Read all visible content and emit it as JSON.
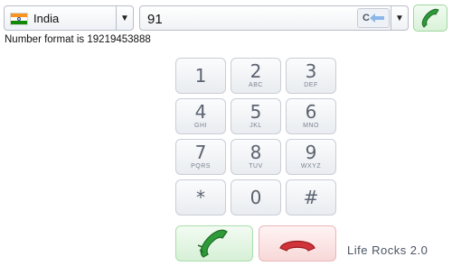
{
  "country": {
    "name": "India"
  },
  "phone": {
    "value": "91",
    "clear_label": "C"
  },
  "hint": {
    "text": "Number format is 19219453888"
  },
  "keypad": [
    {
      "digit": "1",
      "letters": ""
    },
    {
      "digit": "2",
      "letters": "ABC"
    },
    {
      "digit": "3",
      "letters": "DEF"
    },
    {
      "digit": "4",
      "letters": "GHI"
    },
    {
      "digit": "5",
      "letters": "JKL"
    },
    {
      "digit": "6",
      "letters": "MNO"
    },
    {
      "digit": "7",
      "letters": "PQRS"
    },
    {
      "digit": "8",
      "letters": "TUV"
    },
    {
      "digit": "9",
      "letters": "WXYZ"
    },
    {
      "digit": "*",
      "letters": ""
    },
    {
      "digit": "0",
      "letters": ""
    },
    {
      "digit": "#",
      "letters": ""
    }
  ],
  "footer": {
    "brand": "Life Rocks 2.0"
  },
  "colors": {
    "call_green": "#2f9a3a",
    "hangup_red": "#d0343a",
    "back_arrow": "#8ab6e8"
  },
  "icons": {
    "call": "phone-call-icon",
    "hangup": "phone-hangup-icon",
    "backspace": "backspace-arrow-icon",
    "dropdown": "chevron-down-icon",
    "flag": "india-flag-icon"
  }
}
